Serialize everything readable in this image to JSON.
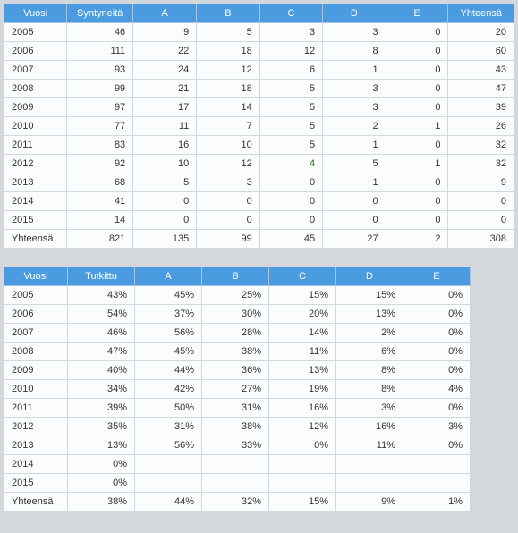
{
  "table1": {
    "headers": [
      "Vuosi",
      "Syntyneitä",
      "A",
      "B",
      "C",
      "D",
      "E",
      "Yhteensä"
    ],
    "rows": [
      {
        "year": "2005",
        "v": "46",
        "a": "9",
        "b": "5",
        "c": "3",
        "d": "3",
        "e": "0",
        "t": "20"
      },
      {
        "year": "2006",
        "v": "111",
        "a": "22",
        "b": "18",
        "c": "12",
        "d": "8",
        "e": "0",
        "t": "60"
      },
      {
        "year": "2007",
        "v": "93",
        "a": "24",
        "b": "12",
        "c": "6",
        "d": "1",
        "e": "0",
        "t": "43"
      },
      {
        "year": "2008",
        "v": "99",
        "a": "21",
        "b": "18",
        "c": "5",
        "d": "3",
        "e": "0",
        "t": "47"
      },
      {
        "year": "2009",
        "v": "97",
        "a": "17",
        "b": "14",
        "c": "5",
        "d": "3",
        "e": "0",
        "t": "39"
      },
      {
        "year": "2010",
        "v": "77",
        "a": "11",
        "b": "7",
        "c": "5",
        "d": "2",
        "e": "1",
        "t": "26"
      },
      {
        "year": "2011",
        "v": "83",
        "a": "16",
        "b": "10",
        "c": "5",
        "d": "1",
        "e": "0",
        "t": "32"
      },
      {
        "year": "2012",
        "v": "92",
        "a": "10",
        "b": "12",
        "c": "4",
        "d": "5",
        "e": "1",
        "t": "32",
        "c_green": true
      },
      {
        "year": "2013",
        "v": "68",
        "a": "5",
        "b": "3",
        "c": "0",
        "d": "1",
        "e": "0",
        "t": "9"
      },
      {
        "year": "2014",
        "v": "41",
        "a": "0",
        "b": "0",
        "c": "0",
        "d": "0",
        "e": "0",
        "t": "0"
      },
      {
        "year": "2015",
        "v": "14",
        "a": "0",
        "b": "0",
        "c": "0",
        "d": "0",
        "e": "0",
        "t": "0"
      },
      {
        "year": "Yhteensä",
        "v": "821",
        "a": "135",
        "b": "99",
        "c": "45",
        "d": "27",
        "e": "2",
        "t": "308"
      }
    ]
  },
  "table2": {
    "headers": [
      "Vuosi",
      "Tutkittu",
      "A",
      "B",
      "C",
      "D",
      "E"
    ],
    "rows": [
      {
        "year": "2005",
        "v": "43%",
        "a": "45%",
        "b": "25%",
        "c": "15%",
        "d": "15%",
        "e": "0%"
      },
      {
        "year": "2006",
        "v": "54%",
        "a": "37%",
        "b": "30%",
        "c": "20%",
        "d": "13%",
        "e": "0%"
      },
      {
        "year": "2007",
        "v": "46%",
        "a": "56%",
        "b": "28%",
        "c": "14%",
        "d": "2%",
        "e": "0%"
      },
      {
        "year": "2008",
        "v": "47%",
        "a": "45%",
        "b": "38%",
        "c": "11%",
        "d": "6%",
        "e": "0%"
      },
      {
        "year": "2009",
        "v": "40%",
        "a": "44%",
        "b": "36%",
        "c": "13%",
        "d": "8%",
        "e": "0%"
      },
      {
        "year": "2010",
        "v": "34%",
        "a": "42%",
        "b": "27%",
        "c": "19%",
        "d": "8%",
        "e": "4%"
      },
      {
        "year": "2011",
        "v": "39%",
        "a": "50%",
        "b": "31%",
        "c": "16%",
        "d": "3%",
        "e": "0%"
      },
      {
        "year": "2012",
        "v": "35%",
        "a": "31%",
        "b": "38%",
        "c": "12%",
        "d": "16%",
        "e": "3%"
      },
      {
        "year": "2013",
        "v": "13%",
        "a": "56%",
        "b": "33%",
        "c": "0%",
        "d": "11%",
        "e": "0%"
      },
      {
        "year": "2014",
        "v": "0%",
        "a": "",
        "b": "",
        "c": "",
        "d": "",
        "e": ""
      },
      {
        "year": "2015",
        "v": "0%",
        "a": "",
        "b": "",
        "c": "",
        "d": "",
        "e": ""
      },
      {
        "year": "Yhteensä",
        "v": "38%",
        "a": "44%",
        "b": "32%",
        "c": "15%",
        "d": "9%",
        "e": "1%"
      }
    ]
  }
}
